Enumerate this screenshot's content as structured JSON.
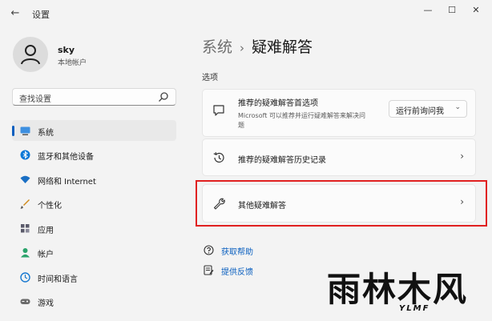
{
  "window": {
    "title": "设置",
    "back_glyph": "←",
    "minimize_glyph": "—",
    "maximize_glyph": "☐",
    "close_glyph": "✕"
  },
  "profile": {
    "name": "sky",
    "account_type": "本地帐户"
  },
  "search": {
    "placeholder": "查找设置"
  },
  "sidebar": {
    "items": [
      {
        "label": "系统",
        "icon": "display-icon",
        "color": "#0a5fbf",
        "active": true
      },
      {
        "label": "蓝牙和其他设备",
        "icon": "bluetooth-icon",
        "color": "#0a78d7",
        "active": false
      },
      {
        "label": "网络和 Internet",
        "icon": "wifi-icon",
        "color": "#1a6fc4",
        "active": false
      },
      {
        "label": "个性化",
        "icon": "brush-icon",
        "color": "#c4780a",
        "active": false
      },
      {
        "label": "应用",
        "icon": "apps-icon",
        "color": "#5a5a6a",
        "active": false
      },
      {
        "label": "帐户",
        "icon": "account-icon",
        "color": "#2aa36b",
        "active": false
      },
      {
        "label": "时间和语言",
        "icon": "globe-clock-icon",
        "color": "#1a7ad0",
        "active": false
      },
      {
        "label": "游戏",
        "icon": "gamepad-icon",
        "color": "#6a6a6a",
        "active": false
      }
    ]
  },
  "main": {
    "breadcrumb_parent": "系统",
    "breadcrumb_sep": "›",
    "breadcrumb_current": "疑难解答",
    "section_label": "选项",
    "cards": [
      {
        "title": "推荐的疑难解答首选项",
        "description": "Microsoft 可以推荐并运行疑难解答来解决问题",
        "dropdown_value": "运行前询问我",
        "dropdown_arrow": "⌄"
      },
      {
        "title": "推荐的疑难解答历史记录",
        "chevron": "›"
      },
      {
        "title": "其他疑难解答",
        "chevron": "›"
      }
    ],
    "links": [
      {
        "label": "获取帮助",
        "icon": "help-icon"
      },
      {
        "label": "提供反馈",
        "icon": "feedback-icon"
      }
    ]
  },
  "watermark": {
    "main": "雨林木风",
    "sub": "YLMF"
  },
  "colors": {
    "accent": "#0a5fbf",
    "highlight_border": "#e02020"
  }
}
